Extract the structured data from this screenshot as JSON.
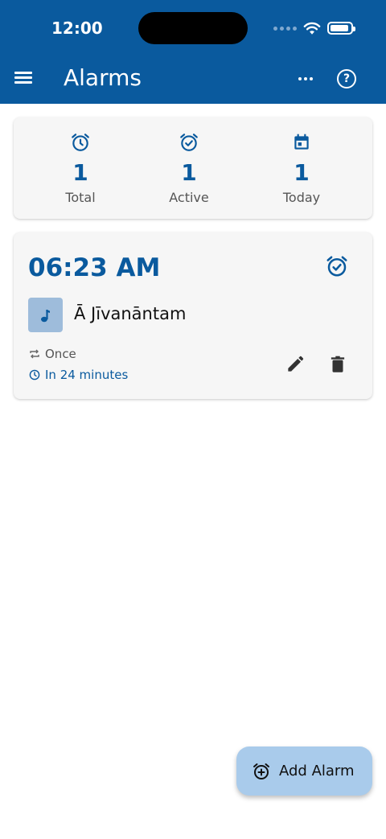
{
  "status_bar": {
    "time": "12:00"
  },
  "app_bar": {
    "title": "Alarms"
  },
  "stats": [
    {
      "icon": "alarm-clock-icon",
      "value": "1",
      "label": "Total"
    },
    {
      "icon": "alarm-check-icon",
      "value": "1",
      "label": "Active"
    },
    {
      "icon": "calendar-icon",
      "value": "1",
      "label": "Today"
    }
  ],
  "alarm": {
    "time": "06:23 AM",
    "song": "Ā Jīvanāntam",
    "repeat": "Once",
    "due": "In 24 minutes"
  },
  "fab": {
    "label": "Add Alarm"
  },
  "colors": {
    "primary": "#0a5a9e",
    "fab": "#a9cbeb",
    "card": "#f6f6f6"
  }
}
